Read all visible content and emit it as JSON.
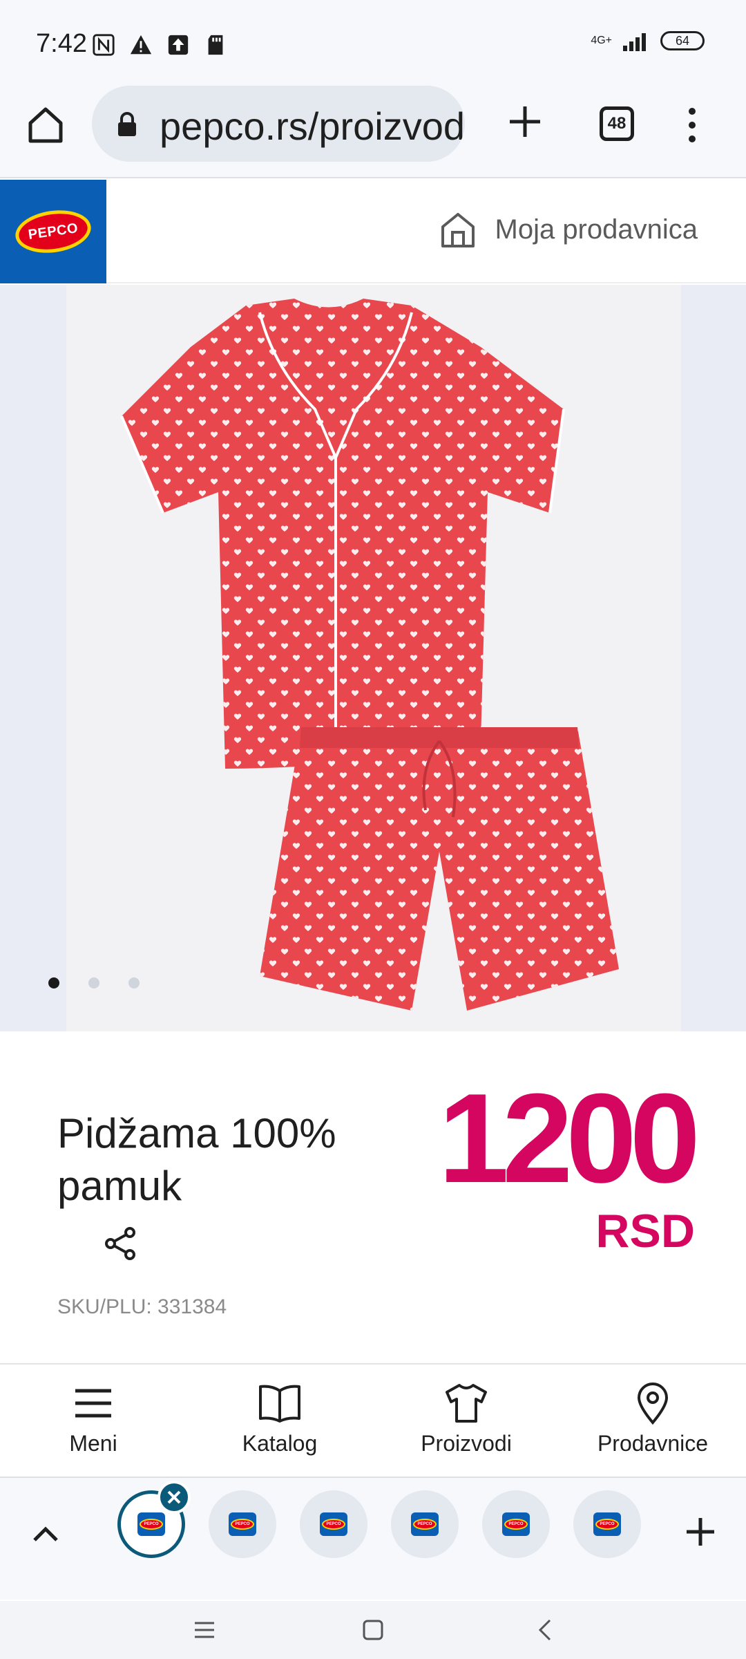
{
  "status_bar": {
    "time": "7:42",
    "network": "4G+",
    "battery": "64"
  },
  "browser": {
    "url": "pepco.rs/proizvodi",
    "tab_count": "48"
  },
  "site_header": {
    "logo_text": "PEPCO",
    "store_label": "Moja prodavnica",
    "brand_color": "#0a5fb4",
    "logo_red": "#e3001b",
    "logo_yellow": "#ffd200"
  },
  "gallery": {
    "image_count": 3,
    "active_index": 0,
    "product_color": "#e8474e"
  },
  "product": {
    "title": "Pidžama 100% pamuk",
    "price": "1200",
    "currency": "RSD",
    "sku": "SKU/PLU: 331384",
    "price_color": "#d4065f"
  },
  "bottom_nav": {
    "items": [
      {
        "label": "Meni",
        "icon": "menu-icon"
      },
      {
        "label": "Katalog",
        "icon": "book-icon"
      },
      {
        "label": "Proizvodi",
        "icon": "tshirt-icon"
      },
      {
        "label": "Prodavnice",
        "icon": "location-pin-icon"
      }
    ]
  },
  "tab_strip": {
    "favicon_text": "PEPCO"
  }
}
